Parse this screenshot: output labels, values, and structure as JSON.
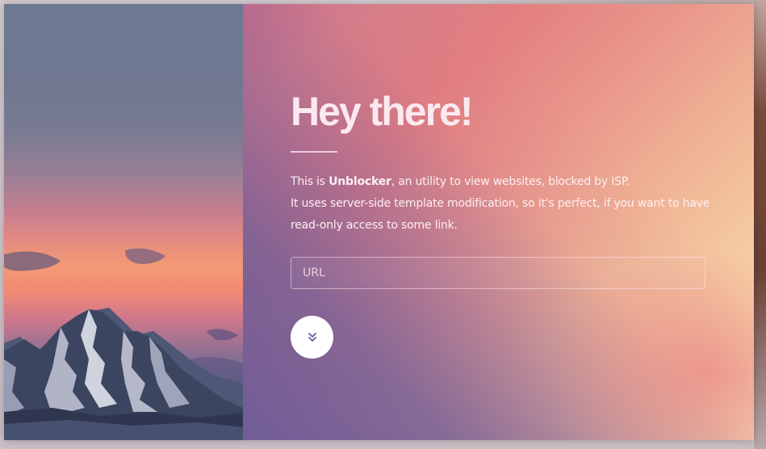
{
  "hero": {
    "title": "Hey there!",
    "desc_prefix": "This is ",
    "app_name": "Unblocker",
    "desc_suffix": ", an utility to view websites, blocked by ISP.",
    "desc_line2": "It uses server-side template modification, so it's perfect, if you want to have",
    "desc_line3": "read-only access to some link."
  },
  "form": {
    "url_placeholder": "URL",
    "url_value": "",
    "submit_icon": "double-chevron-down-icon"
  },
  "colors": {
    "button_bg": "#ffffff",
    "icon_color": "#6b5a97",
    "title_color": "#fbe9ef"
  }
}
